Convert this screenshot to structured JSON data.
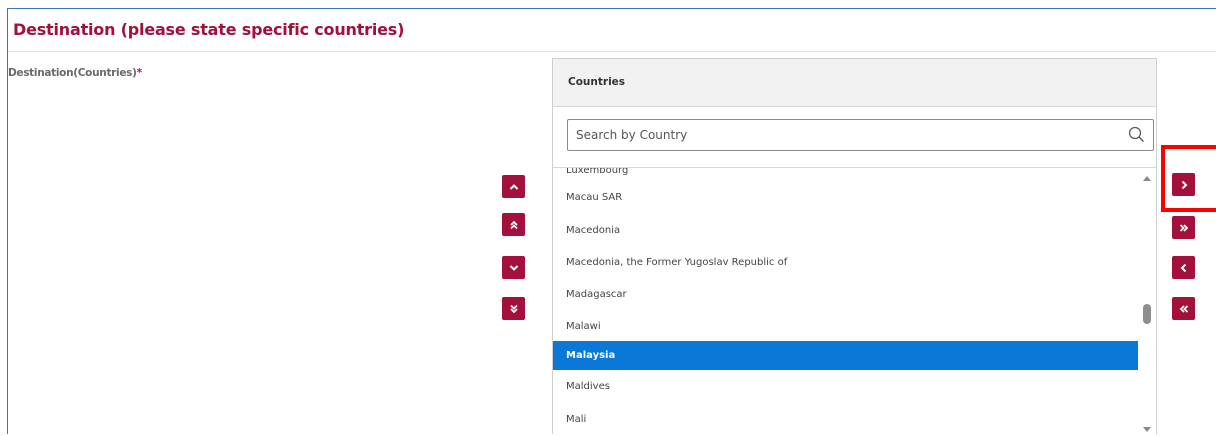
{
  "section": {
    "title": "Destination (please state specific countries)"
  },
  "field": {
    "label": "Destination(Countries)",
    "required_marker": "*"
  },
  "order_buttons": [
    {
      "name": "move-up-button",
      "icon": "chevron-up-icon"
    },
    {
      "name": "move-to-top-button",
      "icon": "double-chevron-up-icon"
    },
    {
      "name": "move-down-button",
      "icon": "chevron-down-icon"
    },
    {
      "name": "move-to-bottom-button",
      "icon": "double-chevron-down-icon"
    }
  ],
  "countries_panel": {
    "title": "Countries",
    "search_placeholder": "Search by Country",
    "search_icon": "search-icon",
    "items": [
      {
        "label": "Luxembourg",
        "selected": false
      },
      {
        "label": "Macau SAR",
        "selected": false
      },
      {
        "label": "Macedonia",
        "selected": false
      },
      {
        "label": "Macedonia, the Former Yugoslav Republic of",
        "selected": false
      },
      {
        "label": "Madagascar",
        "selected": false
      },
      {
        "label": "Malawi",
        "selected": false
      },
      {
        "label": "Malaysia",
        "selected": true
      },
      {
        "label": "Maldives",
        "selected": false
      },
      {
        "label": "Mali",
        "selected": false
      }
    ]
  },
  "transfer_buttons": [
    {
      "name": "move-selected-right-button",
      "icon": "chevron-right-icon",
      "highlighted": true
    },
    {
      "name": "move-all-right-button",
      "icon": "double-chevron-right-icon",
      "highlighted": false
    },
    {
      "name": "move-selected-left-button",
      "icon": "chevron-left-icon",
      "highlighted": false
    },
    {
      "name": "move-all-left-button",
      "icon": "double-chevron-left-icon",
      "highlighted": false
    }
  ],
  "colors": {
    "accent": "#a3103c",
    "selection": "#0a78d7",
    "highlight": "#ff0000"
  }
}
